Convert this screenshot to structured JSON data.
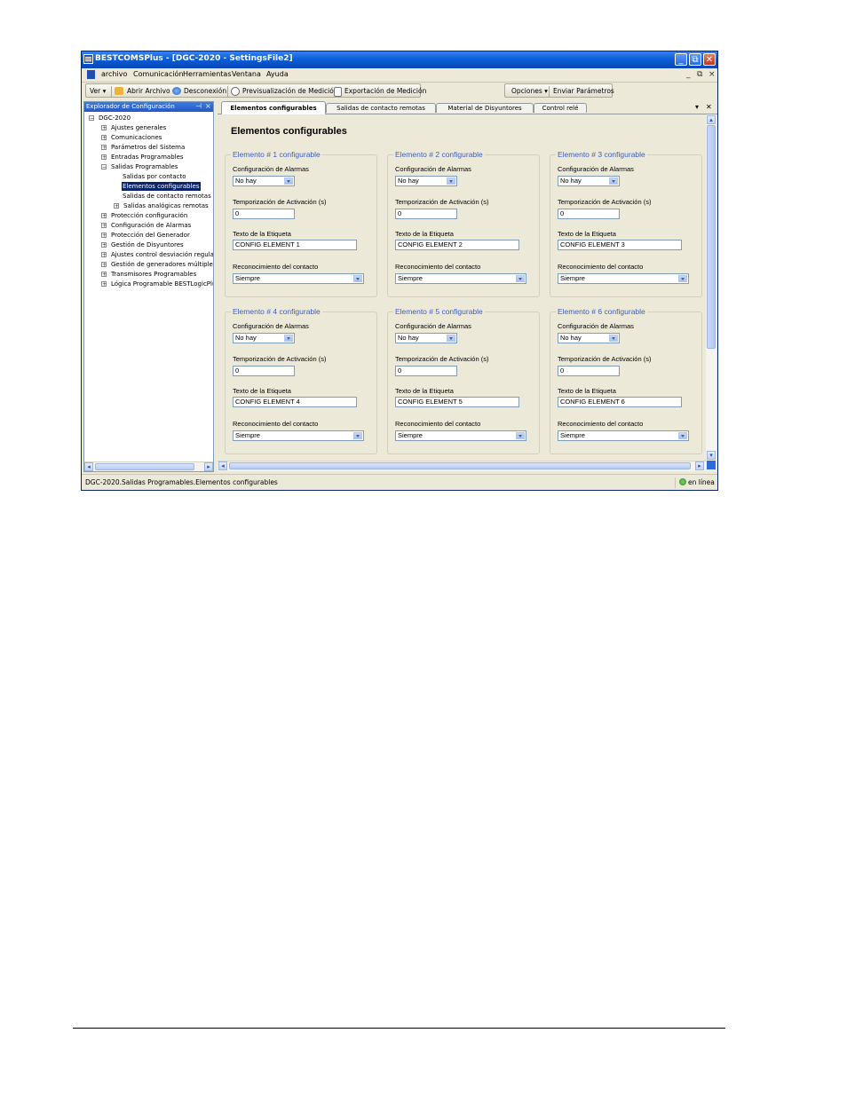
{
  "window": {
    "title": "BESTCOMSPlus - [DGC-2020 - SettingsFile2]",
    "controls": {
      "minimize": "_",
      "restore": "⧉",
      "close": "✕"
    }
  },
  "menu": {
    "items": [
      "archivo",
      "Comunicación",
      "Herramientas",
      "Ventana",
      "Ayuda"
    ],
    "mdi_controls": [
      "_",
      "⧉",
      "×"
    ]
  },
  "toolbar": {
    "ver": "Ver ▾",
    "open": "Abrir Archivo",
    "disconnect": "Desconexión",
    "preview": "Previsualización de Medición",
    "export": "Exportación de Medición",
    "options": "Opciones ▾",
    "send": "Enviar Parámetros"
  },
  "explorer": {
    "title": "Explorador de Configuración",
    "pin": "⊣",
    "close": "×",
    "root": "DGC-2020",
    "items": [
      "Ajustes generales",
      "Comunicaciones",
      "Parámetros del Sistema",
      "Entradas Programables",
      "Salidas Programables",
      "Salidas por contacto",
      "Elementos configurables",
      "Salidas de contacto remotas",
      "Salidas analógicas remotas",
      "Protección configuración",
      "Configuración de Alarmas",
      "Protección del Generador",
      "Gestión de Disyuntores",
      "Ajustes control desviación regulad",
      "Gestión de generadores múltiples",
      "Transmisores Programables",
      "Lógica Programable BESTLogicPlus"
    ]
  },
  "tabs": {
    "items": [
      "Elementos configurables",
      "Salidas de contacto remotas",
      "Material de Disyuntores",
      "Control relé"
    ],
    "active": 0,
    "controls": {
      "menu": "▾",
      "close": "✕"
    }
  },
  "page": {
    "title": "Elementos configurables"
  },
  "field_labels": {
    "alarm": "Configuración de Alarmas",
    "delay": "Temporización de Activación (s)",
    "label": "Texto de la Etiqueta",
    "ack": "Reconocimiento del contacto"
  },
  "elements": [
    {
      "title": "Elemento # 1 configurable",
      "alarm": "No hay",
      "delay": "0",
      "label": "CONFIG ELEMENT 1",
      "ack": "Siempre"
    },
    {
      "title": "Elemento # 2 configurable",
      "alarm": "No hay",
      "delay": "0",
      "label": "CONFIG ELEMENT 2",
      "ack": "Siempre"
    },
    {
      "title": "Elemento # 3 configurable",
      "alarm": "No hay",
      "delay": "0",
      "label": "CONFIG ELEMENT 3",
      "ack": "Siempre"
    },
    {
      "title": "Elemento # 4 configurable",
      "alarm": "No hay",
      "delay": "0",
      "label": "CONFIG ELEMENT 4",
      "ack": "Siempre"
    },
    {
      "title": "Elemento # 5 configurable",
      "alarm": "No hay",
      "delay": "0",
      "label": "CONFIG ELEMENT 5",
      "ack": "Siempre"
    },
    {
      "title": "Elemento # 6 configurable",
      "alarm": "No hay",
      "delay": "0",
      "label": "CONFIG ELEMENT 6",
      "ack": "Siempre"
    }
  ],
  "status": {
    "path": "DGC-2020.Salidas Programables.Elementos configurables",
    "connection": "en línea"
  },
  "colors": {
    "titlebar": "#0a5fd8",
    "group_title": "#3d5fc4",
    "selection": "#0a246a",
    "window_bg": "#ece9d8"
  }
}
